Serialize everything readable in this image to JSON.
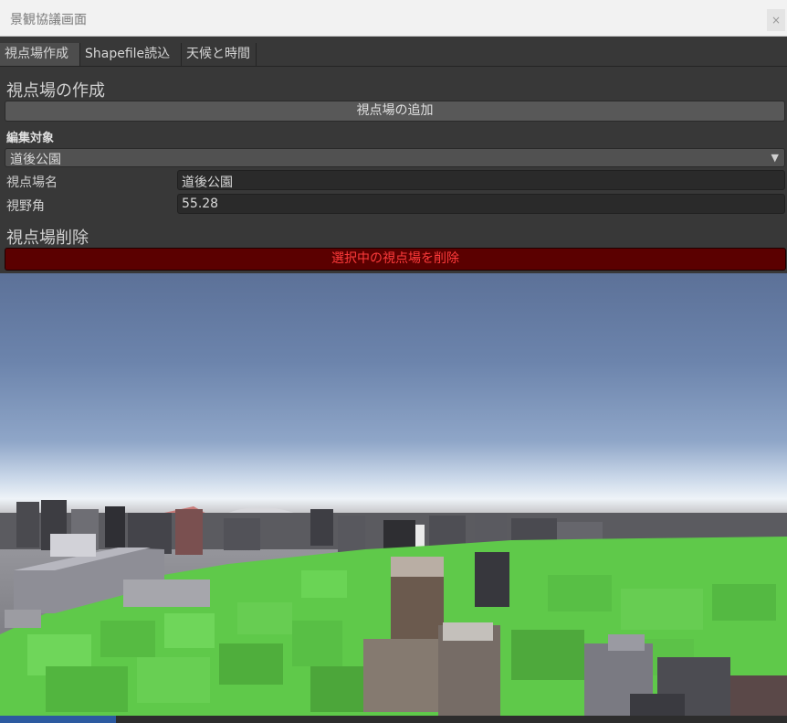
{
  "window": {
    "title": "景観協議画面",
    "close_label": "×"
  },
  "tabs": [
    {
      "label": "視点場作成",
      "active": true
    },
    {
      "label": "Shapefile読込",
      "active": false
    },
    {
      "label": "天候と時間",
      "active": false
    }
  ],
  "create_section": {
    "title": "視点場の作成",
    "add_button": "視点場の追加"
  },
  "edit_target": {
    "label": "編集対象",
    "selected": "道後公園"
  },
  "fields": {
    "name": {
      "label": "視点場名",
      "value": "道後公園"
    },
    "fov": {
      "label": "視野角",
      "value": "55.28"
    }
  },
  "delete_section": {
    "title": "視点場削除",
    "delete_button": "選択中の視点場を削除"
  },
  "colors": {
    "panel_bg": "#383838",
    "delete_button_bg": "#5b0000",
    "delete_button_text": "#ff3b3b",
    "active_tab_bg": "#4d4d4d",
    "highlight_green": "#5fc94a"
  }
}
